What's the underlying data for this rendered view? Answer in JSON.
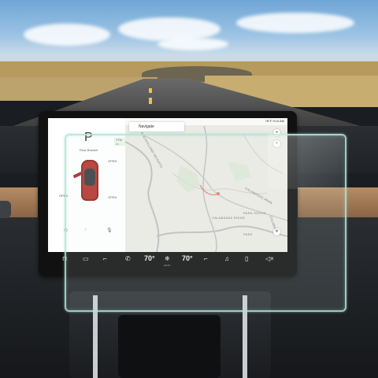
{
  "screen": {
    "gear": "P",
    "speed_limit": "77% ▭",
    "open_front": "OPEN",
    "open_rear": "OPEN",
    "open_left": "OPEN",
    "open_right": "OPEN",
    "rear_label": "Rear Bracket"
  },
  "map": {
    "nav_label": "Navigate",
    "status_time": "78°F  9:15 AM",
    "labels": [
      "MULHOLLAND HEIGHTS",
      "CALABASAS PARK",
      "PARK SOUTH",
      "CALABASAS RIDGE",
      "CALABASAS",
      "PARK"
    ]
  },
  "taskbar": {
    "temp_left": "70°",
    "temp_right": "70°",
    "auto_label": "AUTO",
    "fan_label": "❄"
  },
  "colors": {
    "car": "#b4302b",
    "protector_edge": "#aae6d7",
    "wood": "#a57a55"
  }
}
